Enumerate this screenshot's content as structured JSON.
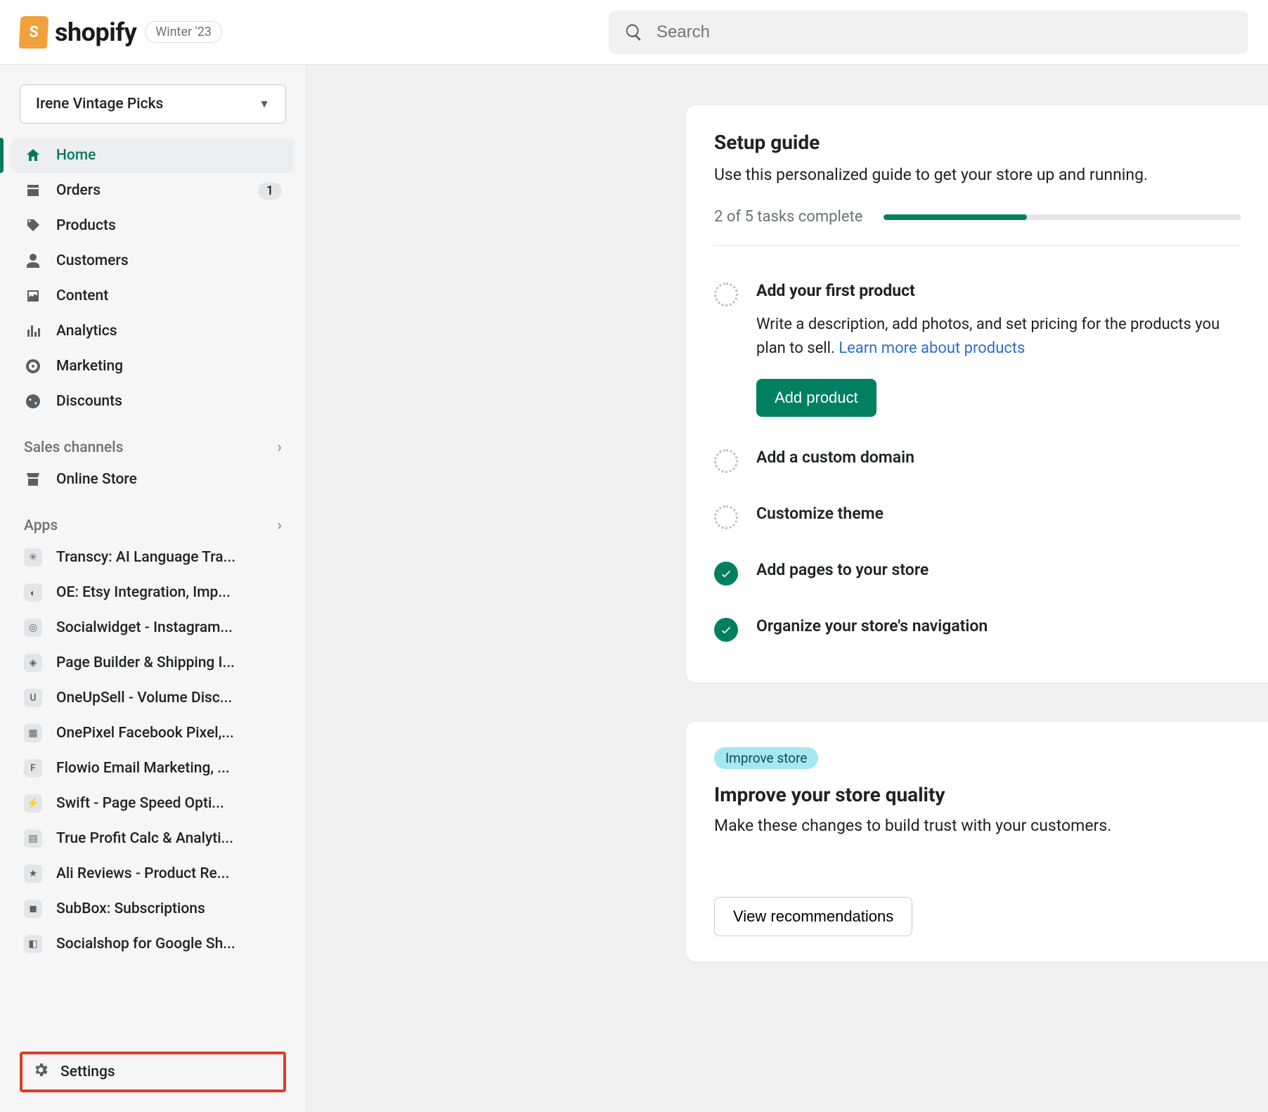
{
  "header": {
    "brand": "shopify",
    "winter_badge": "Winter '23",
    "search_placeholder": "Search"
  },
  "store_selector": {
    "name": "Irene Vintage Picks"
  },
  "nav": {
    "items": [
      {
        "label": "Home",
        "icon": "home"
      },
      {
        "label": "Orders",
        "icon": "orders",
        "badge": "1"
      },
      {
        "label": "Products",
        "icon": "products"
      },
      {
        "label": "Customers",
        "icon": "customers"
      },
      {
        "label": "Content",
        "icon": "content"
      },
      {
        "label": "Analytics",
        "icon": "analytics"
      },
      {
        "label": "Marketing",
        "icon": "marketing"
      },
      {
        "label": "Discounts",
        "icon": "discounts"
      }
    ],
    "sales_channels_label": "Sales channels",
    "sales_channels": [
      {
        "label": "Online Store"
      }
    ],
    "apps_label": "Apps",
    "apps": [
      {
        "label": "Transcy: AI Language Tra..."
      },
      {
        "label": "OE: Etsy Integration, Imp..."
      },
      {
        "label": "Socialwidget - Instagram..."
      },
      {
        "label": "Page Builder & Shipping I..."
      },
      {
        "label": "OneUpSell - Volume Disc..."
      },
      {
        "label": "OnePixel Facebook Pixel,..."
      },
      {
        "label": "Flowio Email Marketing, ..."
      },
      {
        "label": "Swift - Page Speed Opti..."
      },
      {
        "label": "True Profit Calc & Analyti..."
      },
      {
        "label": "Ali Reviews - Product Re..."
      },
      {
        "label": "SubBox: Subscriptions"
      },
      {
        "label": "Socialshop for Google Sh..."
      }
    ],
    "settings_label": "Settings"
  },
  "setup": {
    "title": "Setup guide",
    "subtitle": "Use this personalized guide to get your store up and running.",
    "progress_text": "2 of 5 tasks complete",
    "progress_pct": 40,
    "tasks": [
      {
        "title": "Add your first product",
        "done": false,
        "expanded": true,
        "desc_pre": "Write a description, add photos, and set pricing for the products you plan to sell. ",
        "desc_link": "Learn more about products",
        "action": "Add product"
      },
      {
        "title": "Add a custom domain",
        "done": false
      },
      {
        "title": "Customize theme",
        "done": false
      },
      {
        "title": "Add pages to your store",
        "done": true
      },
      {
        "title": "Organize your store's navigation",
        "done": true
      }
    ]
  },
  "improve": {
    "badge": "Improve store",
    "title": "Improve your store quality",
    "subtitle": "Make these changes to build trust with your customers.",
    "action": "View recommendations"
  }
}
